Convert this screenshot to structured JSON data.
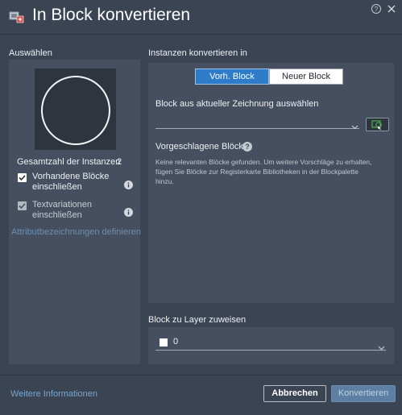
{
  "window": {
    "title": "In Block konvertieren",
    "title_icon": "block-convert-icon",
    "help_icon": "help-icon",
    "close_icon": "close-icon"
  },
  "left": {
    "section_label": "Auswählen",
    "count_label": "Gesamtzahl der Instanzen",
    "count_value": "2",
    "checkboxes": [
      {
        "label": "Vorhandene Blöcke einschließen",
        "checked": true
      },
      {
        "label": "Textvariationen einschließen",
        "checked": true,
        "disabled": true
      }
    ],
    "attr_link": "Attributbezeichnungen definieren"
  },
  "right": {
    "section_label": "Instanzen konvertieren in",
    "tabs": [
      {
        "label": "Vorh. Block",
        "active": true
      },
      {
        "label": "Neuer Block",
        "active": false
      }
    ],
    "select_label": "Block aus aktueller Zeichnung auswählen",
    "select_value": "",
    "suggested_label": "Vorgeschlagene Blöcke",
    "help_glyph": "?",
    "suggested_text": "Keine relevanten Blöcke gefunden. Um weitere Vorschläge zu erhalten, fügen Sie Blöcke zur Registerkarte Bibliotheken in der Blockpalette hinzu.",
    "layer_section_label": "Block zu Layer zuweisen",
    "layer_value": "0",
    "layer_color": "#ffffff"
  },
  "footer": {
    "more_info": "Weitere Informationen",
    "cancel": "Abbrechen",
    "convert": "Konvertieren"
  },
  "colors": {
    "background": "#3b4453",
    "panel": "#454f60",
    "accent": "#2d7bc9",
    "link": "#76a7d4"
  }
}
